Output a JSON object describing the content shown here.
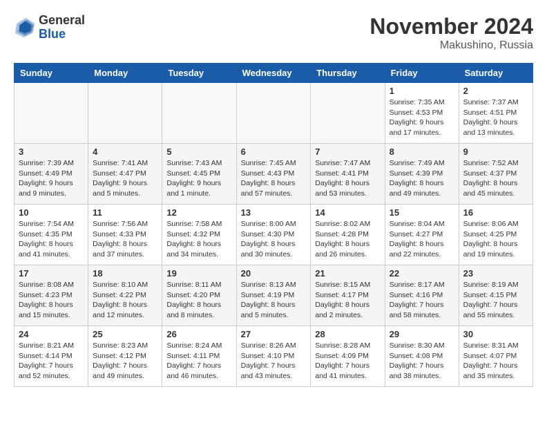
{
  "logo": {
    "general": "General",
    "blue": "Blue"
  },
  "header": {
    "month": "November 2024",
    "location": "Makushino, Russia"
  },
  "weekdays": [
    "Sunday",
    "Monday",
    "Tuesday",
    "Wednesday",
    "Thursday",
    "Friday",
    "Saturday"
  ],
  "weeks": [
    [
      {
        "day": "",
        "info": ""
      },
      {
        "day": "",
        "info": ""
      },
      {
        "day": "",
        "info": ""
      },
      {
        "day": "",
        "info": ""
      },
      {
        "day": "",
        "info": ""
      },
      {
        "day": "1",
        "info": "Sunrise: 7:35 AM\nSunset: 4:53 PM\nDaylight: 9 hours and 17 minutes."
      },
      {
        "day": "2",
        "info": "Sunrise: 7:37 AM\nSunset: 4:51 PM\nDaylight: 9 hours and 13 minutes."
      }
    ],
    [
      {
        "day": "3",
        "info": "Sunrise: 7:39 AM\nSunset: 4:49 PM\nDaylight: 9 hours and 9 minutes."
      },
      {
        "day": "4",
        "info": "Sunrise: 7:41 AM\nSunset: 4:47 PM\nDaylight: 9 hours and 5 minutes."
      },
      {
        "day": "5",
        "info": "Sunrise: 7:43 AM\nSunset: 4:45 PM\nDaylight: 9 hours and 1 minute."
      },
      {
        "day": "6",
        "info": "Sunrise: 7:45 AM\nSunset: 4:43 PM\nDaylight: 8 hours and 57 minutes."
      },
      {
        "day": "7",
        "info": "Sunrise: 7:47 AM\nSunset: 4:41 PM\nDaylight: 8 hours and 53 minutes."
      },
      {
        "day": "8",
        "info": "Sunrise: 7:49 AM\nSunset: 4:39 PM\nDaylight: 8 hours and 49 minutes."
      },
      {
        "day": "9",
        "info": "Sunrise: 7:52 AM\nSunset: 4:37 PM\nDaylight: 8 hours and 45 minutes."
      }
    ],
    [
      {
        "day": "10",
        "info": "Sunrise: 7:54 AM\nSunset: 4:35 PM\nDaylight: 8 hours and 41 minutes."
      },
      {
        "day": "11",
        "info": "Sunrise: 7:56 AM\nSunset: 4:33 PM\nDaylight: 8 hours and 37 minutes."
      },
      {
        "day": "12",
        "info": "Sunrise: 7:58 AM\nSunset: 4:32 PM\nDaylight: 8 hours and 34 minutes."
      },
      {
        "day": "13",
        "info": "Sunrise: 8:00 AM\nSunset: 4:30 PM\nDaylight: 8 hours and 30 minutes."
      },
      {
        "day": "14",
        "info": "Sunrise: 8:02 AM\nSunset: 4:28 PM\nDaylight: 8 hours and 26 minutes."
      },
      {
        "day": "15",
        "info": "Sunrise: 8:04 AM\nSunset: 4:27 PM\nDaylight: 8 hours and 22 minutes."
      },
      {
        "day": "16",
        "info": "Sunrise: 8:06 AM\nSunset: 4:25 PM\nDaylight: 8 hours and 19 minutes."
      }
    ],
    [
      {
        "day": "17",
        "info": "Sunrise: 8:08 AM\nSunset: 4:23 PM\nDaylight: 8 hours and 15 minutes."
      },
      {
        "day": "18",
        "info": "Sunrise: 8:10 AM\nSunset: 4:22 PM\nDaylight: 8 hours and 12 minutes."
      },
      {
        "day": "19",
        "info": "Sunrise: 8:11 AM\nSunset: 4:20 PM\nDaylight: 8 hours and 8 minutes."
      },
      {
        "day": "20",
        "info": "Sunrise: 8:13 AM\nSunset: 4:19 PM\nDaylight: 8 hours and 5 minutes."
      },
      {
        "day": "21",
        "info": "Sunrise: 8:15 AM\nSunset: 4:17 PM\nDaylight: 8 hours and 2 minutes."
      },
      {
        "day": "22",
        "info": "Sunrise: 8:17 AM\nSunset: 4:16 PM\nDaylight: 7 hours and 58 minutes."
      },
      {
        "day": "23",
        "info": "Sunrise: 8:19 AM\nSunset: 4:15 PM\nDaylight: 7 hours and 55 minutes."
      }
    ],
    [
      {
        "day": "24",
        "info": "Sunrise: 8:21 AM\nSunset: 4:14 PM\nDaylight: 7 hours and 52 minutes."
      },
      {
        "day": "25",
        "info": "Sunrise: 8:23 AM\nSunset: 4:12 PM\nDaylight: 7 hours and 49 minutes."
      },
      {
        "day": "26",
        "info": "Sunrise: 8:24 AM\nSunset: 4:11 PM\nDaylight: 7 hours and 46 minutes."
      },
      {
        "day": "27",
        "info": "Sunrise: 8:26 AM\nSunset: 4:10 PM\nDaylight: 7 hours and 43 minutes."
      },
      {
        "day": "28",
        "info": "Sunrise: 8:28 AM\nSunset: 4:09 PM\nDaylight: 7 hours and 41 minutes."
      },
      {
        "day": "29",
        "info": "Sunrise: 8:30 AM\nSunset: 4:08 PM\nDaylight: 7 hours and 38 minutes."
      },
      {
        "day": "30",
        "info": "Sunrise: 8:31 AM\nSunset: 4:07 PM\nDaylight: 7 hours and 35 minutes."
      }
    ]
  ]
}
